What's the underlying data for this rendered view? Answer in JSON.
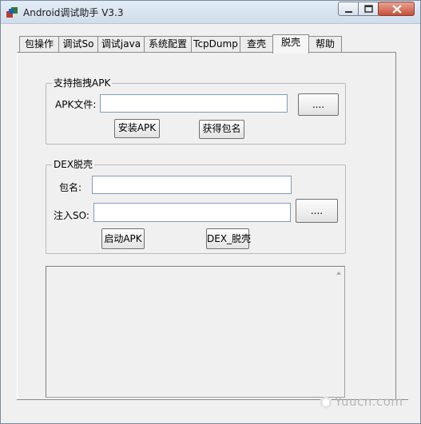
{
  "window": {
    "title": "Android调试助手 V3.3",
    "app_icon": "app-icon"
  },
  "tabs": [
    {
      "label": "包操作"
    },
    {
      "label": "调试So"
    },
    {
      "label": "调试java"
    },
    {
      "label": "系统配置"
    },
    {
      "label": "TcpDump"
    },
    {
      "label": "查壳"
    },
    {
      "label": "脱壳"
    },
    {
      "label": "帮助"
    }
  ],
  "active_tab": "脱壳",
  "apk_group": {
    "title": "支持拖拽APK",
    "file_label": "APK文件:",
    "file_value": "",
    "browse_label": "....",
    "install_label": "安装APK",
    "get_package_label": "获得包名"
  },
  "dex_group": {
    "title": "DEX脱壳",
    "package_label": "包名:",
    "package_value": "",
    "so_label": "注入SO:",
    "so_value": "",
    "browse_label": "....",
    "start_apk_label": "启动APK",
    "dex_unpack_label": "DEX_脱壳"
  },
  "output": {
    "text": ""
  },
  "watermark": {
    "text": "Yuucn.com"
  }
}
